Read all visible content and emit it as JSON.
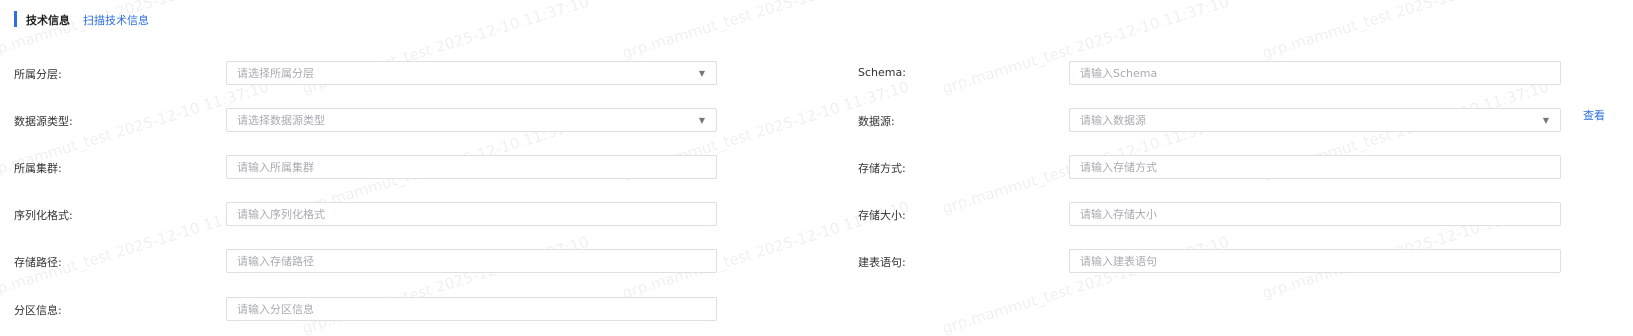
{
  "section": {
    "title": "技术信息",
    "scan_link": "扫描技术信息"
  },
  "left_fields": [
    {
      "label": "所属分层:",
      "placeholder": "请选择所属分层",
      "type": "select"
    },
    {
      "label": "数据源类型:",
      "placeholder": "请选择数据源类型",
      "type": "select"
    },
    {
      "label": "所属集群:",
      "placeholder": "请输入所属集群",
      "type": "input"
    },
    {
      "label": "序列化格式:",
      "placeholder": "请输入序列化格式",
      "type": "input"
    },
    {
      "label": "存储路径:",
      "placeholder": "请输入存储路径",
      "type": "input"
    },
    {
      "label": "分区信息:",
      "placeholder": "请输入分区信息",
      "type": "input"
    }
  ],
  "right_fields": [
    {
      "label": "Schema:",
      "placeholder": "请输入Schema",
      "type": "input"
    },
    {
      "label": "数据源:",
      "placeholder": "请输入数据源",
      "type": "select"
    },
    {
      "label": "存储方式:",
      "placeholder": "请输入存储方式",
      "type": "input"
    },
    {
      "label": "存储大小:",
      "placeholder": "请输入存储大小",
      "type": "input"
    },
    {
      "label": "建表语句:",
      "placeholder": "请输入建表语句",
      "type": "input"
    }
  ],
  "view_link": "查看",
  "watermark": "grp.mammut_test 2025-12-10 11:37:10",
  "icons": {
    "dropdown": "caret-down-icon"
  },
  "colors": {
    "accent": "#2f6fe0",
    "border": "#dcdfe6",
    "placeholder": "#a8abb2"
  }
}
